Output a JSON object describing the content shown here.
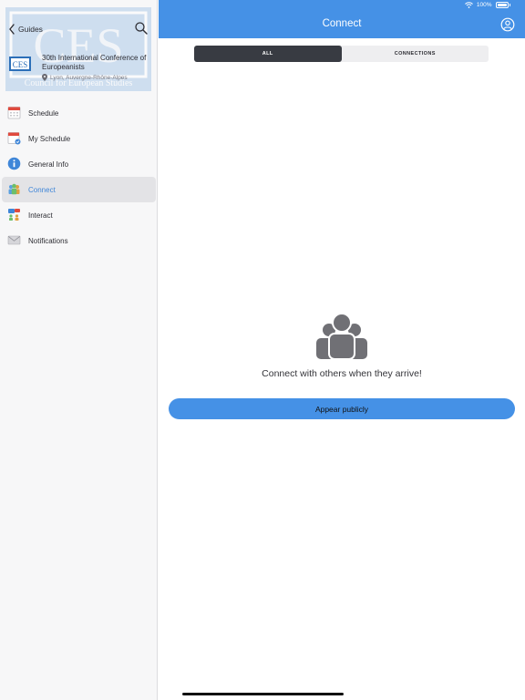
{
  "sidebar": {
    "back_label": "Guides",
    "guide": {
      "title": "30th International Conference of Europeanists",
      "location": "Lyon, Auvergne-Rhône-Alpes",
      "logo_text": "CES",
      "banner_text": "Council for European Studies"
    },
    "items": [
      {
        "label": "Schedule",
        "icon": "calendar-icon"
      },
      {
        "label": "My Schedule",
        "icon": "my-schedule-icon"
      },
      {
        "label": "General Info",
        "icon": "info-icon"
      },
      {
        "label": "Connect",
        "icon": "people-icon",
        "active": true
      },
      {
        "label": "Interact",
        "icon": "interact-icon"
      },
      {
        "label": "Notifications",
        "icon": "envelope-icon"
      }
    ]
  },
  "header": {
    "title": "Connect",
    "battery": "100%"
  },
  "tabs": [
    {
      "label": "ALL",
      "active": true
    },
    {
      "label": "CONNECTIONS",
      "active": false
    }
  ],
  "empty_state": {
    "message": "Connect with others when they arrive!"
  },
  "actions": {
    "appear_publicly": "Appear publicly"
  },
  "colors": {
    "accent": "#4591e6",
    "active_tab": "#383b42",
    "sidebar_bg": "#f7f7f8"
  }
}
